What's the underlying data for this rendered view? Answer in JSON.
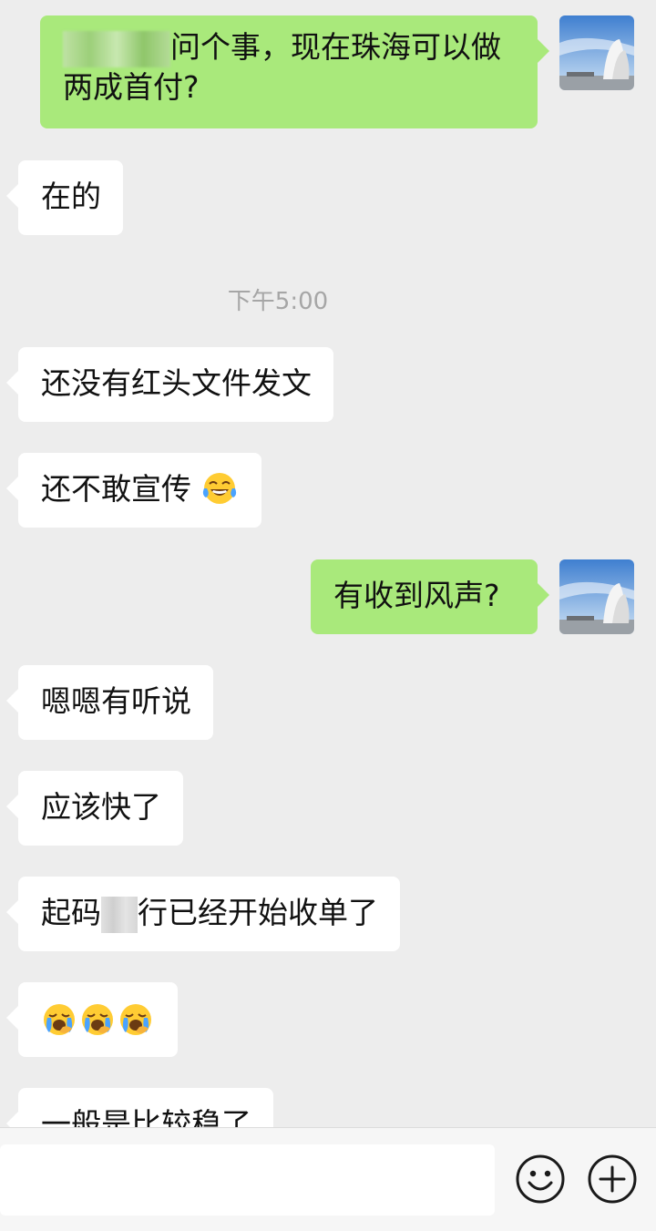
{
  "messages": [
    {
      "side": "right",
      "text": "问个事，现在珠海可以做",
      "text2": "两成首付?",
      "redacted_prefix": true
    },
    {
      "side": "left",
      "text": "在的"
    },
    {
      "type": "timestamp",
      "text": "下午5:00"
    },
    {
      "side": "left",
      "text": "还没有红头文件发文"
    },
    {
      "side": "left",
      "text": "还不敢宣传",
      "emoji": [
        "tears-of-joy"
      ]
    },
    {
      "side": "right",
      "text": "有收到风声?"
    },
    {
      "side": "left",
      "text": "嗯嗯有听说"
    },
    {
      "side": "left",
      "text": "应该快了"
    },
    {
      "side": "left",
      "text_before": "起码",
      "text_after": "行已经开始收单了",
      "redacted_middle": true
    },
    {
      "side": "left",
      "text": "",
      "emoji": [
        "loudly-crying",
        "loudly-crying",
        "loudly-crying"
      ]
    },
    {
      "side": "left",
      "text": "一般是比较稳了"
    }
  ],
  "input_bar": {
    "input_value": "",
    "buttons": [
      "emoji-icon",
      "plus-icon"
    ]
  },
  "colors": {
    "background": "#ededed",
    "bubble_self": "#a9e97b",
    "bubble_other": "#ffffff",
    "timestamp": "#a6a6a6"
  }
}
